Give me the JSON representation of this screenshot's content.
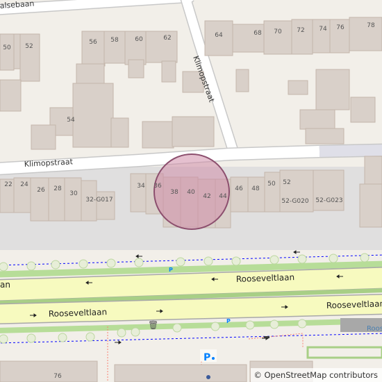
{
  "map": {
    "colors": {
      "background": "#f2efe9",
      "building": "#d9d0c9",
      "building_stroke": "#c4b6ab",
      "road": "#ffffff",
      "road_casing": "#c8c8c8",
      "arterial": "#f7fabf",
      "green_strip": "#cde8b0",
      "parking": "#eeeeee",
      "cycleway": "#0000ff",
      "footway": "#fa8072",
      "radius_fill": "#cf8ca8",
      "radius_stroke": "#8c4f6e"
    },
    "streets": {
      "top": "alsebaan",
      "klimop_diagonal": "Klimopstraat",
      "klimop_main": "Klimopstraat",
      "roosevelt_1": "Rooseveltlaan",
      "roosevelt_2": "Rooseveltlaan",
      "roosevelt_3": "Rooseveltlaan",
      "roosevelt_left": "an",
      "roosevelt_cut": "Roos"
    },
    "house_numbers": {
      "n50": "50",
      "n52": "52",
      "n56": "56",
      "n58": "58",
      "n60": "60",
      "n62": "62",
      "n64": "64",
      "n68": "68",
      "n70": "70",
      "n72": "72",
      "n74": "74",
      "n76": "76",
      "n78": "78",
      "n54": "54",
      "n22": "22",
      "n24": "24",
      "n26": "26",
      "n28": "28",
      "n30": "30",
      "n32g017": "32-G017",
      "n34": "34",
      "n36": "36",
      "n38": "38",
      "n40": "40",
      "n42": "42",
      "n44": "44",
      "n46": "46",
      "n48": "48",
      "n50b": "50",
      "n52b": "52",
      "n52g020": "52-G020",
      "n52g023": "52-G023",
      "n76b": "76"
    },
    "markers": {
      "parking_small": "P",
      "parking_small_2": "P",
      "parking_bike": "P",
      "waste_basket": "🗑"
    },
    "attribution": "© OpenStreetMap contributors"
  }
}
